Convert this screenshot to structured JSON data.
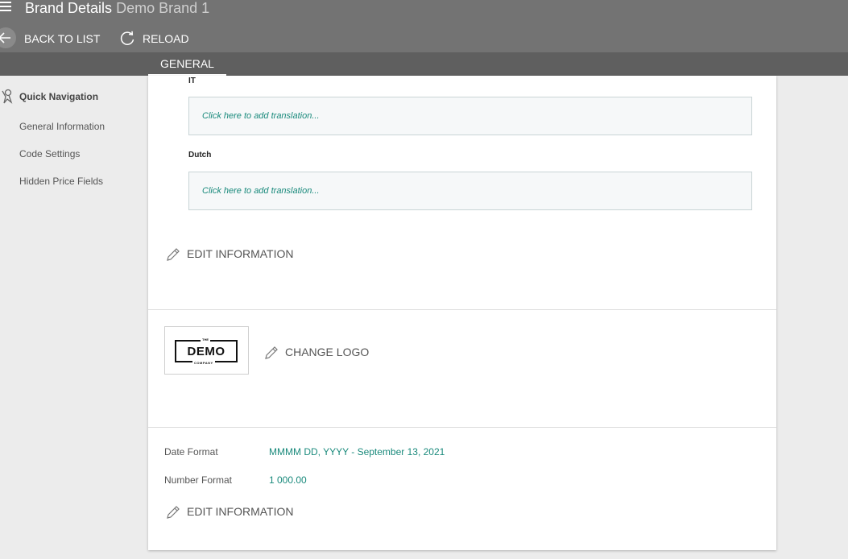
{
  "header": {
    "title": "Brand Details",
    "subtitle": "Demo Brand 1",
    "back_label": "BACK TO LIST",
    "reload_label": "RELOAD"
  },
  "tabs": [
    {
      "label": "GENERAL"
    }
  ],
  "sidebar": {
    "title": "Quick Navigation",
    "items": [
      {
        "label": "General Information"
      },
      {
        "label": "Code Settings"
      },
      {
        "label": "Hidden Price Fields"
      }
    ]
  },
  "translations": [
    {
      "language": "IT",
      "placeholder": "Click here to add translation..."
    },
    {
      "language": "Dutch",
      "placeholder": "Click here to add translation..."
    }
  ],
  "edit_information_label": "EDIT INFORMATION",
  "logo": {
    "change_label": "CHANGE LOGO",
    "the": "THE",
    "demo": "DEMO",
    "company": "COMPANY"
  },
  "formats": {
    "date": {
      "label": "Date Format",
      "value": "MMMM DD, YYYY - September 13, 2021"
    },
    "number": {
      "label": "Number Format",
      "value": "1 000.00"
    }
  },
  "colors": {
    "header": "#737373",
    "tabbar": "#5f5f5f",
    "accent": "#1a8a7c",
    "background": "#ececec"
  }
}
